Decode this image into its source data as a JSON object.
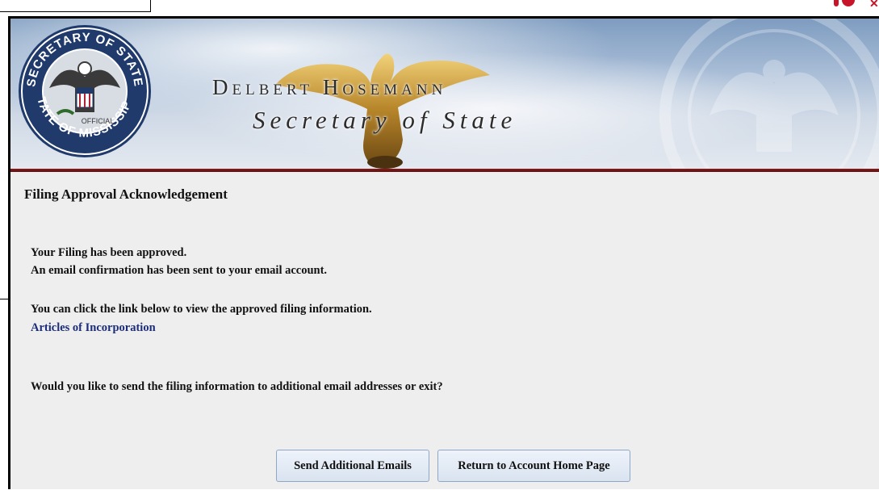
{
  "header": {
    "official_name": "Delbert Hosemann",
    "office_title": "Secretary of State",
    "seal_text_top": "SECRETARY OF STATE",
    "seal_text_bottom": "STATE OF MISSISSIPPI",
    "seal_text_center": "OFFICIAL",
    "colors": {
      "accent_bar": "#8b1a1a",
      "link": "#1c2e7a"
    }
  },
  "page": {
    "heading": "Filing Approval Acknowledgement",
    "approved_message": "Your Filing has been approved.",
    "email_message": "An email confirmation has been sent to your email account.",
    "view_instruction": "You can click the link below to view the approved filing information.",
    "filing_link": "Articles of Incorporation",
    "question": "Would you like to send the filing information to additional email addresses or exit?"
  },
  "actions": {
    "send_label": "Send Additional Emails",
    "return_label": "Return to Account Home Page"
  }
}
